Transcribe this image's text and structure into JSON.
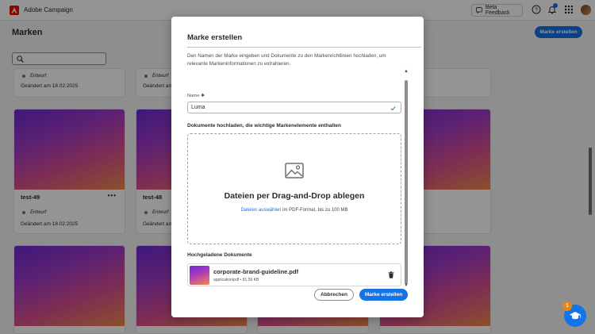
{
  "app": {
    "name": "Adobe Campaign",
    "beta_feedback": "Beta Feedback"
  },
  "page": {
    "title": "Marken",
    "create_button": "Marke erstellen",
    "search": {
      "placeholder": ""
    }
  },
  "cards": [
    {
      "name": "",
      "status": "Entwurf",
      "date": "Geändert am 18.02.2025"
    },
    {
      "name": "",
      "status": "Entwurf",
      "date": "Geändert am 18.02.2025"
    },
    {
      "name": "test-49",
      "more": "•••",
      "status": "Entwurf",
      "date": "Geändert am 18.02.2025"
    },
    {
      "name": "test-48",
      "more": "•••",
      "status": "Entwurf",
      "date": "Geändert am 18.02.2025"
    }
  ],
  "modal": {
    "title": "Marke erstellen",
    "description": "Den Namen der Marke eingeben und Dokumente zu den Markenrichtlinien hochladen, um relevante Markeninformationen zu extrahieren.",
    "name_label": "Name ✱",
    "name_value": "Luma",
    "upload_label": "Dokumente hochladen, die wichtige Markenelemente enthalten",
    "dropzone_title": "Dateien per Drag-and-Drop ablegen",
    "dropzone_link": "Dateien auswählen",
    "dropzone_hint": " im PDF-Format, bis zu 100 MB",
    "uploaded_label": "Hochgeladene Dokumente",
    "file": {
      "name": "corporate-brand-guideline.pdf",
      "meta": "application/pdf • 81.56 KB"
    },
    "cancel_label": "Abbrechen",
    "create_label": "Marke erstellen"
  },
  "help": {
    "badge": "1"
  },
  "colors": {
    "accent": "#1473e6",
    "adobe_red": "#eb1000",
    "badge": "#e68619"
  }
}
